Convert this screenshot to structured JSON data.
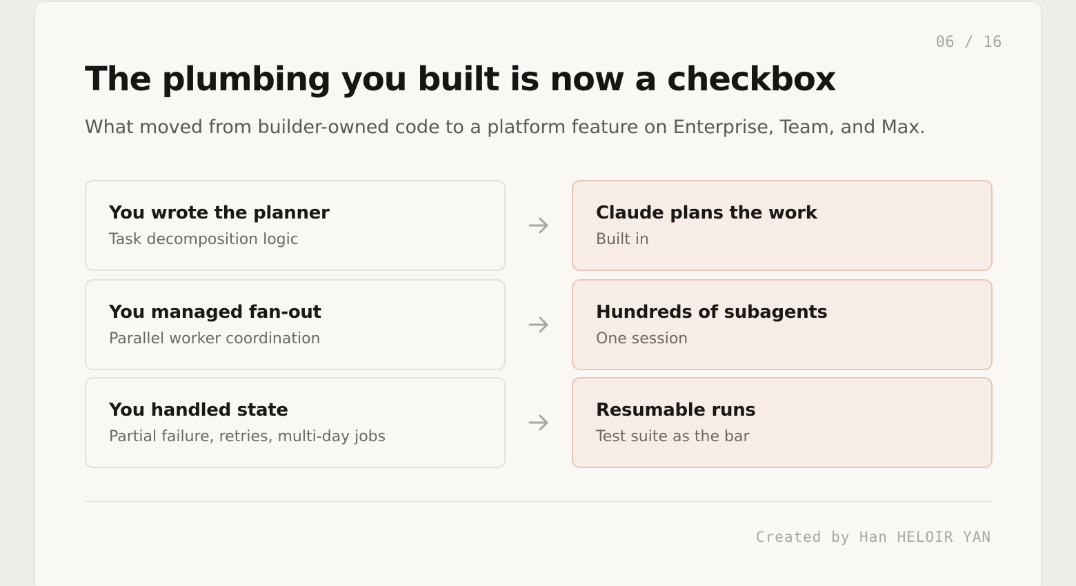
{
  "slide": {
    "page_counter": "06 / 16",
    "title": "The plumbing you built is now a checkbox",
    "subtitle": "What moved from builder-owned code to a platform feature on Enterprise, Team, and Max.",
    "rows": [
      {
        "before": {
          "title": "You wrote the planner",
          "subtitle": "Task decomposition logic"
        },
        "arrow_icon": "arrow-right-icon",
        "after": {
          "title": "Claude plans the work",
          "subtitle": "Built in"
        }
      },
      {
        "before": {
          "title": "You managed fan-out",
          "subtitle": "Parallel worker coordination"
        },
        "arrow_icon": "arrow-right-icon",
        "after": {
          "title": "Hundreds of subagents",
          "subtitle": "One session"
        }
      },
      {
        "before": {
          "title": "You handled state",
          "subtitle": "Partial failure, retries, multi-day jobs"
        },
        "arrow_icon": "arrow-right-icon",
        "after": {
          "title": "Resumable runs",
          "subtitle": "Test suite as the bar"
        }
      }
    ],
    "footer": "Created by Han HELOIR YAN"
  },
  "colors": {
    "page_background": "#efede8",
    "slide_background": "#f9f8f5",
    "before_card_border": "#e3e0d9",
    "after_card_background": "#f8ece6",
    "after_card_border": "#ecc4b4",
    "arrow": "#a9a6a0"
  }
}
